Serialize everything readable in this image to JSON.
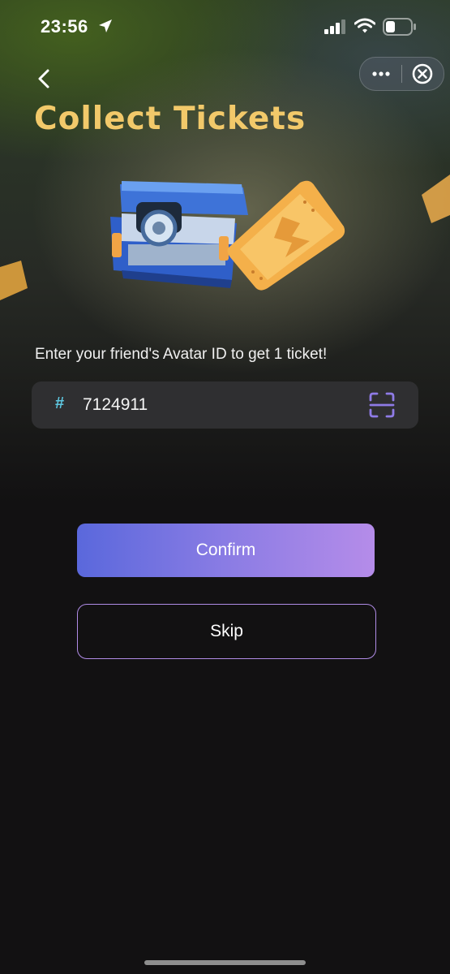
{
  "status_bar": {
    "time": "23:56",
    "icons": [
      "location-arrow-icon",
      "cellular-signal-icon",
      "wifi-icon",
      "battery-icon"
    ]
  },
  "header": {
    "back_icon": "chevron-left-icon",
    "more_icon": "more-dots-icon",
    "close_icon": "circle-close-icon"
  },
  "title": "Collect Tickets",
  "instruction": "Enter your friend's Avatar ID to get 1 ticket!",
  "id_field": {
    "prefix_icon": "hash-icon",
    "value": "7124911",
    "scan_icon": "scan-icon"
  },
  "buttons": {
    "confirm_label": "Confirm",
    "skip_label": "Skip"
  },
  "colors": {
    "title": "#f2c96a",
    "background": "#121112",
    "field_bg": "#2f2f31",
    "hash": "#5ec7e0",
    "scan": "#8f7be6",
    "confirm_gradient_start": "#5a68dc",
    "confirm_gradient_end": "#b58ce9",
    "skip_border": "#b08ce6"
  }
}
